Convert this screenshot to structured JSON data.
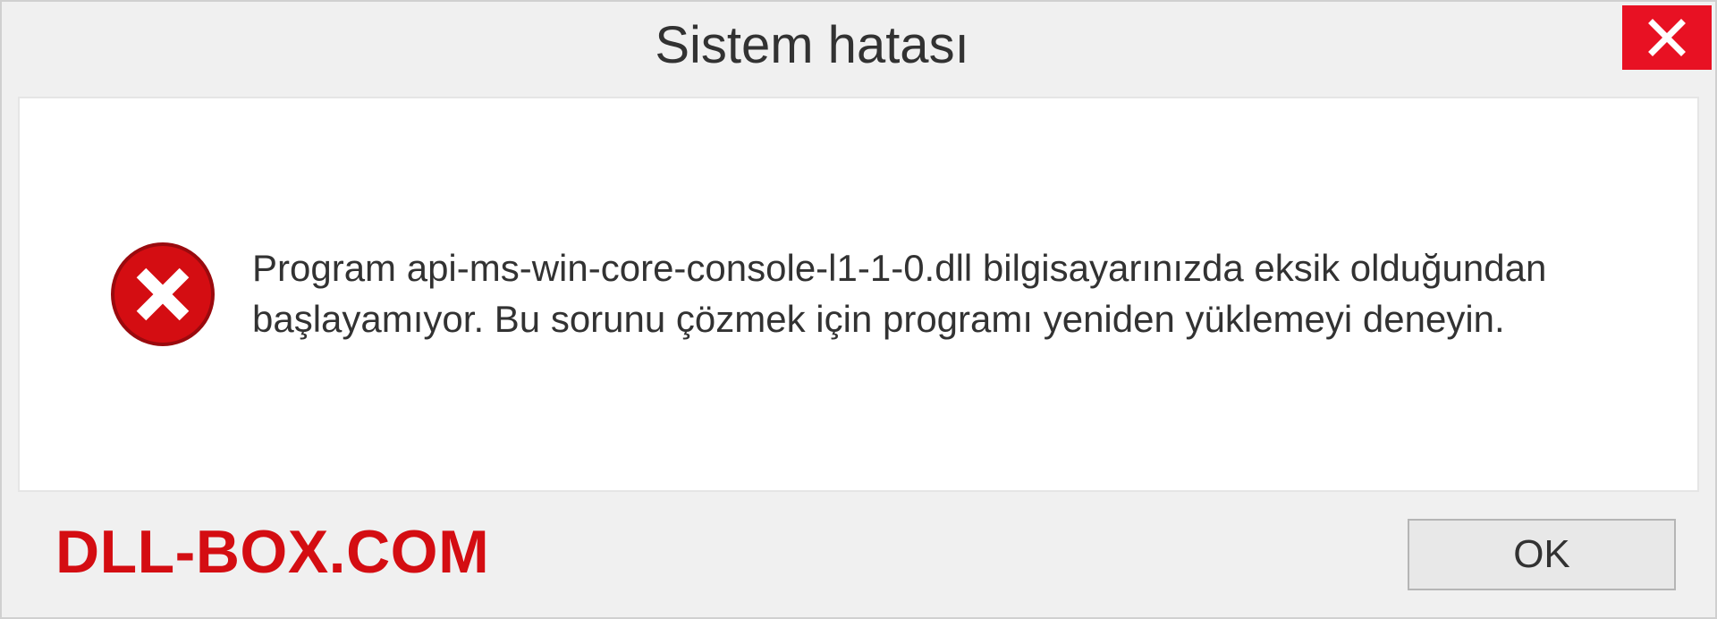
{
  "dialog": {
    "title": "Sistem hatası",
    "message": "Program api-ms-win-core-console-l1-1-0.dll bilgisayarınızda eksik olduğundan başlayamıyor. Bu sorunu çözmek için programı yeniden yüklemeyi deneyin.",
    "ok_label": "OK"
  },
  "watermark": "DLL-BOX.COM",
  "colors": {
    "close_bg": "#e81123",
    "error_red": "#d40d12",
    "text": "#323232"
  }
}
